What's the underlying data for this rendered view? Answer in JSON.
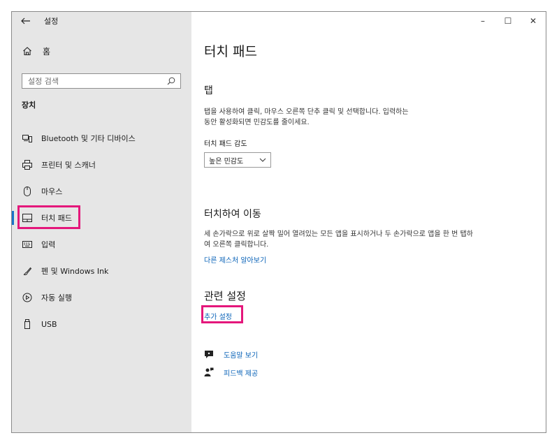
{
  "titlebar": {
    "app_title": "설정",
    "minimize_glyph": "–",
    "maximize_glyph": "☐",
    "close_glyph": "✕"
  },
  "sidebar": {
    "home_label": "홈",
    "search_placeholder": "설정 검색",
    "section_title": "장치",
    "items": [
      {
        "label": "Bluetooth 및 기타 디바이스",
        "icon": "bluetooth-devices-icon"
      },
      {
        "label": "프린터 및 스캐너",
        "icon": "printer-icon"
      },
      {
        "label": "마우스",
        "icon": "mouse-icon"
      },
      {
        "label": "터치 패드",
        "icon": "touchpad-icon",
        "selected": true
      },
      {
        "label": "입력",
        "icon": "keyboard-icon"
      },
      {
        "label": "펜 및 Windows Ink",
        "icon": "pen-icon"
      },
      {
        "label": "자동 실행",
        "icon": "autoplay-icon"
      },
      {
        "label": "USB",
        "icon": "usb-icon"
      }
    ]
  },
  "main": {
    "page_title": "터치 패드",
    "tap": {
      "heading": "탭",
      "description_line1": "탭을 사용하여 클릭, 마우스 오른쪽 단추 클릭 및 선택합니다. 입력하는",
      "description_line2": "동안 활성화되면 민감도를 줄이세요.",
      "sensitivity_label": "터치 패드 감도",
      "sensitivity_value": "높은 민감도"
    },
    "scroll": {
      "heading": "터치하여 이동",
      "description_line1": "세 손가락으로 위로 살짝 밀어 열려있는 모든 앱을 표시하거나 두 손가락으로 앱을 한 번 탭하",
      "description_line2": "여 오른쪽 클릭합니다.",
      "link": "다른 제스처 알아보기"
    },
    "related": {
      "heading": "관련 설정",
      "link": "추가 설정"
    },
    "help": {
      "get_help": "도움말 보기",
      "feedback": "피드백 제공"
    }
  },
  "colors": {
    "accent": "#1a73c9",
    "link": "#0a63b8",
    "highlight": "#e4177b",
    "sidebar_bg": "#e6e6e6"
  }
}
